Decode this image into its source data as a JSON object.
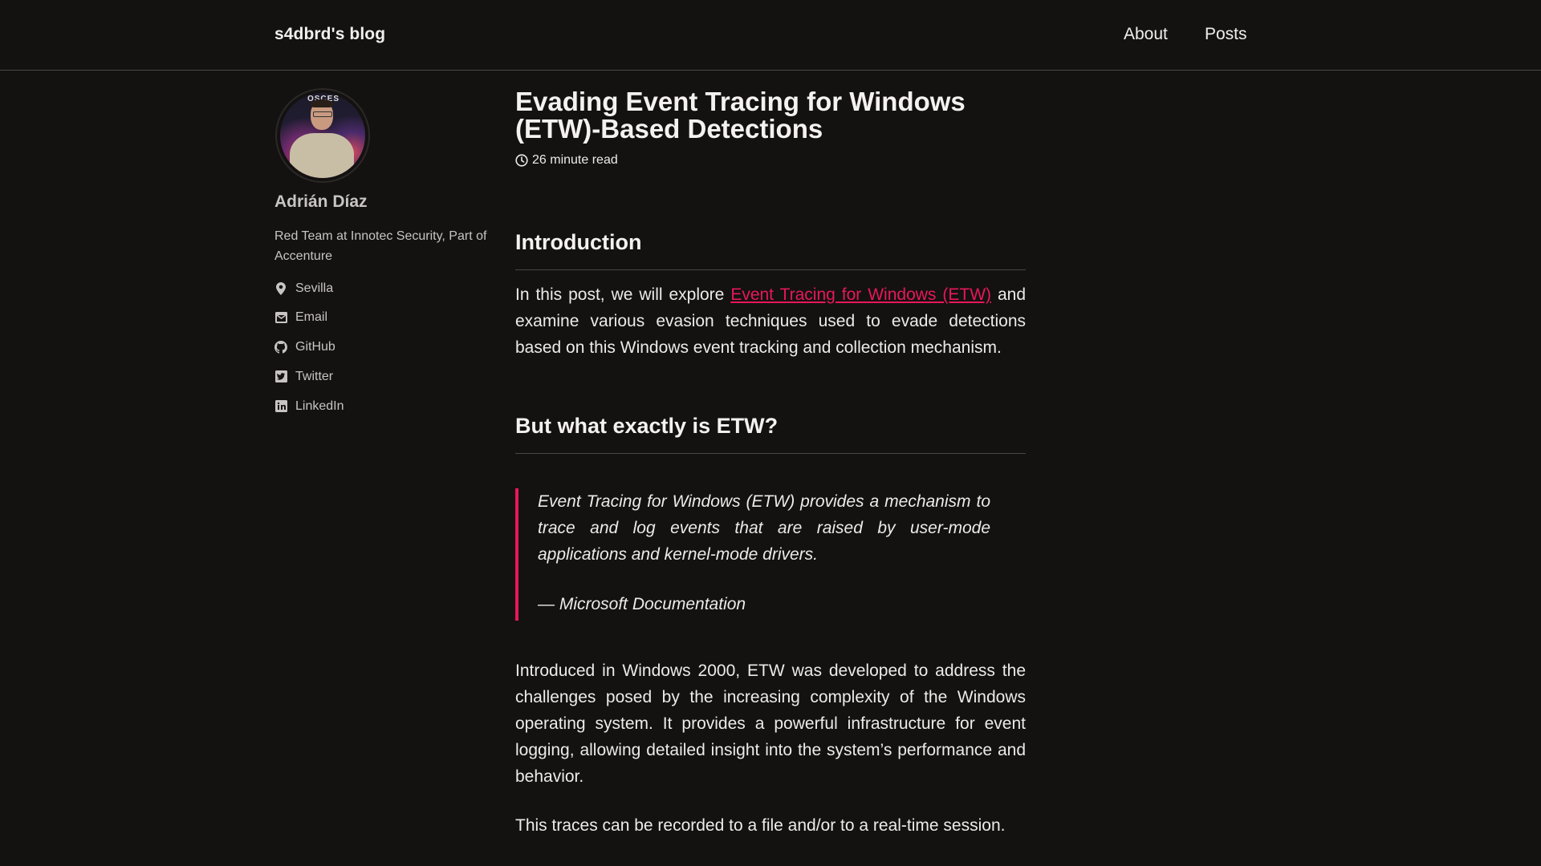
{
  "header": {
    "site_title": "s4dbrd's blog",
    "nav": [
      {
        "label": "About"
      },
      {
        "label": "Posts"
      }
    ]
  },
  "sidebar": {
    "avatar_alt": "Adrián Díaz",
    "avatar_banner": "OSCES",
    "author_name": "Adrián Díaz",
    "author_bio": "Red Team at Innotec Security, Part of Accenture",
    "links": [
      {
        "icon": "location-pin-icon",
        "label": "Sevilla"
      },
      {
        "icon": "email-icon",
        "label": "Email"
      },
      {
        "icon": "github-icon",
        "label": "GitHub"
      },
      {
        "icon": "twitter-icon",
        "label": "Twitter"
      },
      {
        "icon": "linkedin-icon",
        "label": "LinkedIn"
      }
    ]
  },
  "post": {
    "title": "Evading Event Tracing for Windows (ETW)-Based Detections",
    "read_time": "26 minute read",
    "sections": {
      "introduction": {
        "heading": "Introduction",
        "p1_before_link": "In this post, we will explore ",
        "p1_link": "Event Tracing for Windows (ETW)",
        "p1_after_link": " and examine various evasion techniques used to evade detections based on this Windows event tracking and collection mechanism."
      },
      "what_is_etw": {
        "heading": "But what exactly is ETW?",
        "quote": "Event Tracing for Windows (ETW) provides a mechanism to trace and log events that are raised by user-mode applications and kernel-mode drivers.",
        "quote_cite": "— Microsoft Documentation",
        "p2": "Introduced in Windows 2000, ETW was developed to address the challenges posed by the increasing complexity of the Windows operating system. It provides a powerful infrastructure for event logging, allowing detailed insight into the system’s performance and behavior.",
        "p3": "This traces can be recorded to a file and/or to a real-time session."
      }
    }
  },
  "colors": {
    "background": "#141111",
    "accent": "#e8175d",
    "text": "#eeeaea",
    "muted_text": "#c9c4c4",
    "divider": "#4a4646"
  }
}
